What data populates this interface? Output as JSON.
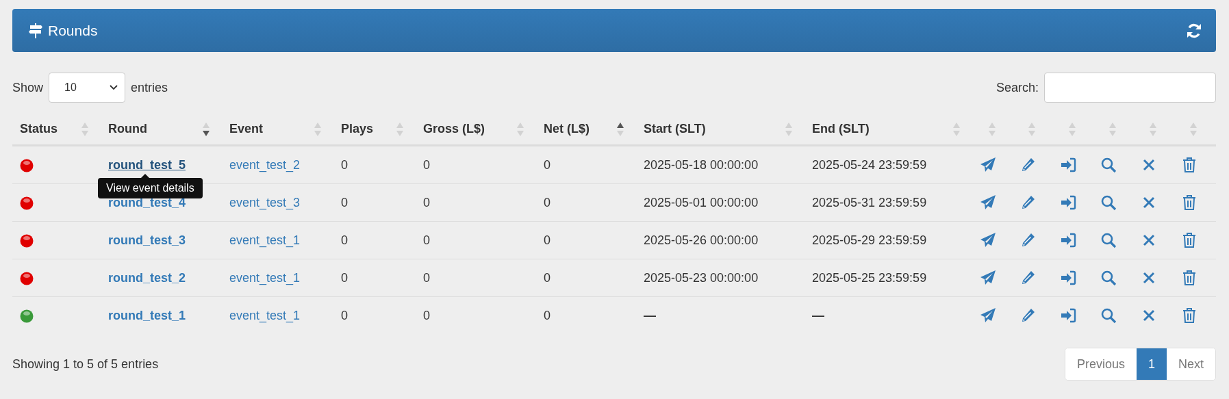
{
  "panel": {
    "title": "Rounds"
  },
  "length_menu": {
    "label_before": "Show",
    "value": "10",
    "label_after": "entries"
  },
  "search": {
    "label": "Search:"
  },
  "table": {
    "columns": [
      {
        "kind": "data",
        "label": "Status",
        "sorted_asc": false,
        "sorted_desc": false
      },
      {
        "kind": "data",
        "label": "Round",
        "sorted_asc": false,
        "sorted_desc": true
      },
      {
        "kind": "data",
        "label": "Event",
        "sorted_asc": false,
        "sorted_desc": false
      },
      {
        "kind": "data",
        "label": "Plays",
        "sorted_asc": false,
        "sorted_desc": false
      },
      {
        "kind": "data",
        "label": "Gross (L$)",
        "sorted_asc": false,
        "sorted_desc": false
      },
      {
        "kind": "data",
        "label": "Net (L$)",
        "sorted_asc": true,
        "sorted_desc": false
      },
      {
        "kind": "data",
        "label": "Start (SLT)",
        "sorted_asc": false,
        "sorted_desc": false
      },
      {
        "kind": "data",
        "label": "End (SLT)",
        "sorted_asc": false,
        "sorted_desc": false
      },
      {
        "kind": "action",
        "sorted_asc": false,
        "sorted_desc": false
      },
      {
        "kind": "action",
        "sorted_asc": false,
        "sorted_desc": false
      },
      {
        "kind": "action",
        "sorted_asc": false,
        "sorted_desc": false
      },
      {
        "kind": "action",
        "sorted_asc": false,
        "sorted_desc": false
      },
      {
        "kind": "action",
        "sorted_asc": false,
        "sorted_desc": false
      },
      {
        "kind": "action",
        "sorted_asc": false,
        "sorted_desc": false
      }
    ],
    "rows": [
      {
        "color": "#e00000",
        "round": "round_test_5",
        "hovered": true,
        "tooltip": "View event details",
        "event": "event_test_2",
        "plays": "0",
        "gross": "0",
        "net": "0",
        "start": "2025-05-18 00:00:00",
        "end": "2025-05-24 23:59:59"
      },
      {
        "color": "#e00000",
        "round": "round_test_4",
        "hovered": false,
        "event": "event_test_3",
        "plays": "0",
        "gross": "0",
        "net": "0",
        "start": "2025-05-01 00:00:00",
        "end": "2025-05-31 23:59:59"
      },
      {
        "color": "#e00000",
        "round": "round_test_3",
        "hovered": false,
        "event": "event_test_1",
        "plays": "0",
        "gross": "0",
        "net": "0",
        "start": "2025-05-26 00:00:00",
        "end": "2025-05-29 23:59:59"
      },
      {
        "color": "#e00000",
        "round": "round_test_2",
        "hovered": false,
        "event": "event_test_1",
        "plays": "0",
        "gross": "0",
        "net": "0",
        "start": "2025-05-23 00:00:00",
        "end": "2025-05-25 23:59:59"
      },
      {
        "color": "#3a9a3a",
        "round": "round_test_1",
        "hovered": false,
        "event": "event_test_1",
        "plays": "0",
        "gross": "0",
        "net": "0",
        "start": "—",
        "end": "—"
      }
    ]
  },
  "info": "Showing 1 to 5 of 5 entries",
  "pagination": [
    {
      "label": "Previous",
      "selected": false
    },
    {
      "label": "1",
      "selected": true
    },
    {
      "label": "Next",
      "selected": false
    }
  ]
}
